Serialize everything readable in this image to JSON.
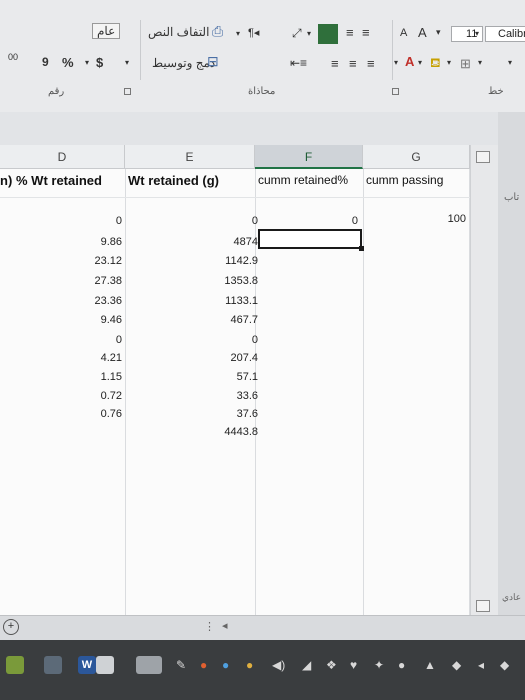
{
  "ribbon": {
    "font_size": "11",
    "font_name": "Calibri",
    "increase_font_glyph": "A",
    "decrease_font_glyph": "A",
    "wrap_text_label": "التفاف النص",
    "merge_center_label": "دمج وتوسيط",
    "general_label": "عام",
    "currency_symbol": "$",
    "percent_symbol": "%",
    "comma_symbol": "9",
    "decimal_label": "00",
    "group_number": "رقم",
    "group_alignment": "محاذاة",
    "group_font": "خط"
  },
  "grid": {
    "columns": [
      "D",
      "E",
      "F",
      "G"
    ],
    "headers": {
      "partial": "n)",
      "d": "% Wt retained",
      "e": "Wt retained (g)",
      "f": "cumm retained%",
      "g": "cumm passing"
    },
    "column_d": [
      "0",
      "9.86",
      "23.12",
      "27.38",
      "23.36",
      "9.46",
      "0",
      "4.21",
      "1.15",
      "0.72",
      "0.76"
    ],
    "column_e": [
      "0",
      "4874",
      "1142.9",
      "1353.8",
      "1133.1",
      "467.7",
      "0",
      "207.4",
      "57.1",
      "33.6",
      "37.6",
      "4443.8"
    ],
    "f_first": "0",
    "g_first": "100"
  },
  "side_text": {
    "right_top": "تاب",
    "right_bottom": "عادي"
  },
  "sheetbar": {
    "add_sheet": "+",
    "dots": "⋮"
  }
}
